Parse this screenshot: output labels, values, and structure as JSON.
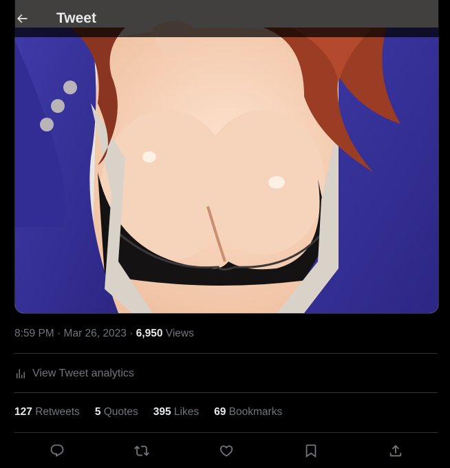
{
  "header": {
    "title": "Tweet"
  },
  "tweet": {
    "time": "8:59 PM",
    "separator": "·",
    "date": "Mar 26, 2023",
    "views_count": "6,950",
    "views_label": "Views",
    "analytics_label": "View Tweet analytics"
  },
  "stats": [
    {
      "count": "127",
      "label": "Retweets"
    },
    {
      "count": "5",
      "label": "Quotes"
    },
    {
      "count": "395",
      "label": "Likes"
    },
    {
      "count": "69",
      "label": "Bookmarks"
    }
  ],
  "actions": [
    "reply-icon",
    "retweet-icon",
    "like-icon",
    "bookmark-icon",
    "share-icon"
  ],
  "colors": {
    "background": "#000000",
    "text": "#e7e9ea",
    "muted": "#71767b",
    "divider": "#2f3336"
  }
}
